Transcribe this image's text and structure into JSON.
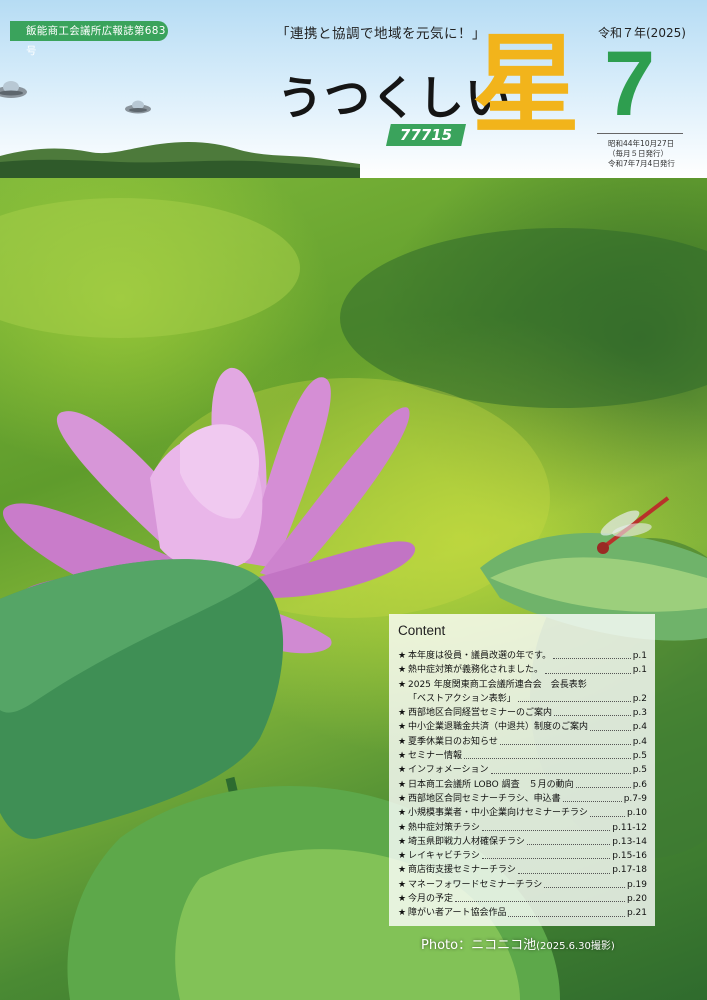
{
  "header": {
    "publication": "飯能商工会議所広報誌第683号",
    "slogan": "「連携と協調で地域を元気に！」",
    "era": "令和７年(2025)",
    "title": "うつくしい",
    "title_kanji": "星",
    "issue_badge": "77715",
    "month": "7",
    "pub_note": [
      "昭和44年10月27日",
      "（毎月５日発行）",
      "令和7年7月4日発行"
    ]
  },
  "content": {
    "title": "Content",
    "items": [
      {
        "text": "本年度は役員・議員改選の年です。",
        "page": "p.1"
      },
      {
        "text": "熱中症対策が義務化されました。",
        "page": "p.1"
      },
      {
        "text": "2025 年度関東商工会議所連合会　会長表彰",
        "page": ""
      },
      {
        "text": "「ベストアクション表彰」",
        "page": "p.2",
        "continuation": true
      },
      {
        "text": "西部地区合同経営セミナーのご案内",
        "page": "p.3"
      },
      {
        "text": "中小企業退職金共済（中退共）制度のご案内",
        "page": "p.4"
      },
      {
        "text": "夏季休業日のお知らせ",
        "page": "p.4"
      },
      {
        "text": "セミナー情報",
        "page": "p.5"
      },
      {
        "text": "インフォメーション",
        "page": "p.5"
      },
      {
        "text": "日本商工会議所 LOBO 調査　５月の動向",
        "page": "p.6"
      },
      {
        "text": "西部地区合同セミナーチラシ、申込書",
        "page": "p.7-9"
      },
      {
        "text": "小規模事業者・中小企業向けセミナーチラシ",
        "page": "p.10"
      },
      {
        "text": "熱中症対策チラシ",
        "page": "p.11-12"
      },
      {
        "text": "埼玉県即戦力人材確保チラシ",
        "page": "p.13-14"
      },
      {
        "text": "レイキャビチラシ",
        "page": "p.15-16"
      },
      {
        "text": "商店街支援セミナーチラシ",
        "page": "p.17-18"
      },
      {
        "text": "マネーフォワードセミナーチラシ",
        "page": "p.19"
      },
      {
        "text": "今月の予定",
        "page": "p.20"
      },
      {
        "text": "障がい者アート協会作品",
        "page": "p.21"
      }
    ]
  },
  "photo": {
    "credit_main": "Photo：ニコニコ池",
    "credit_date": "(2025.6.30撮影)"
  },
  "colors": {
    "accent_green": "#3aa35c",
    "month_green": "#2e9e4f",
    "title_gold": "#f2b41b",
    "lotus_pink": "#d98ad6"
  }
}
